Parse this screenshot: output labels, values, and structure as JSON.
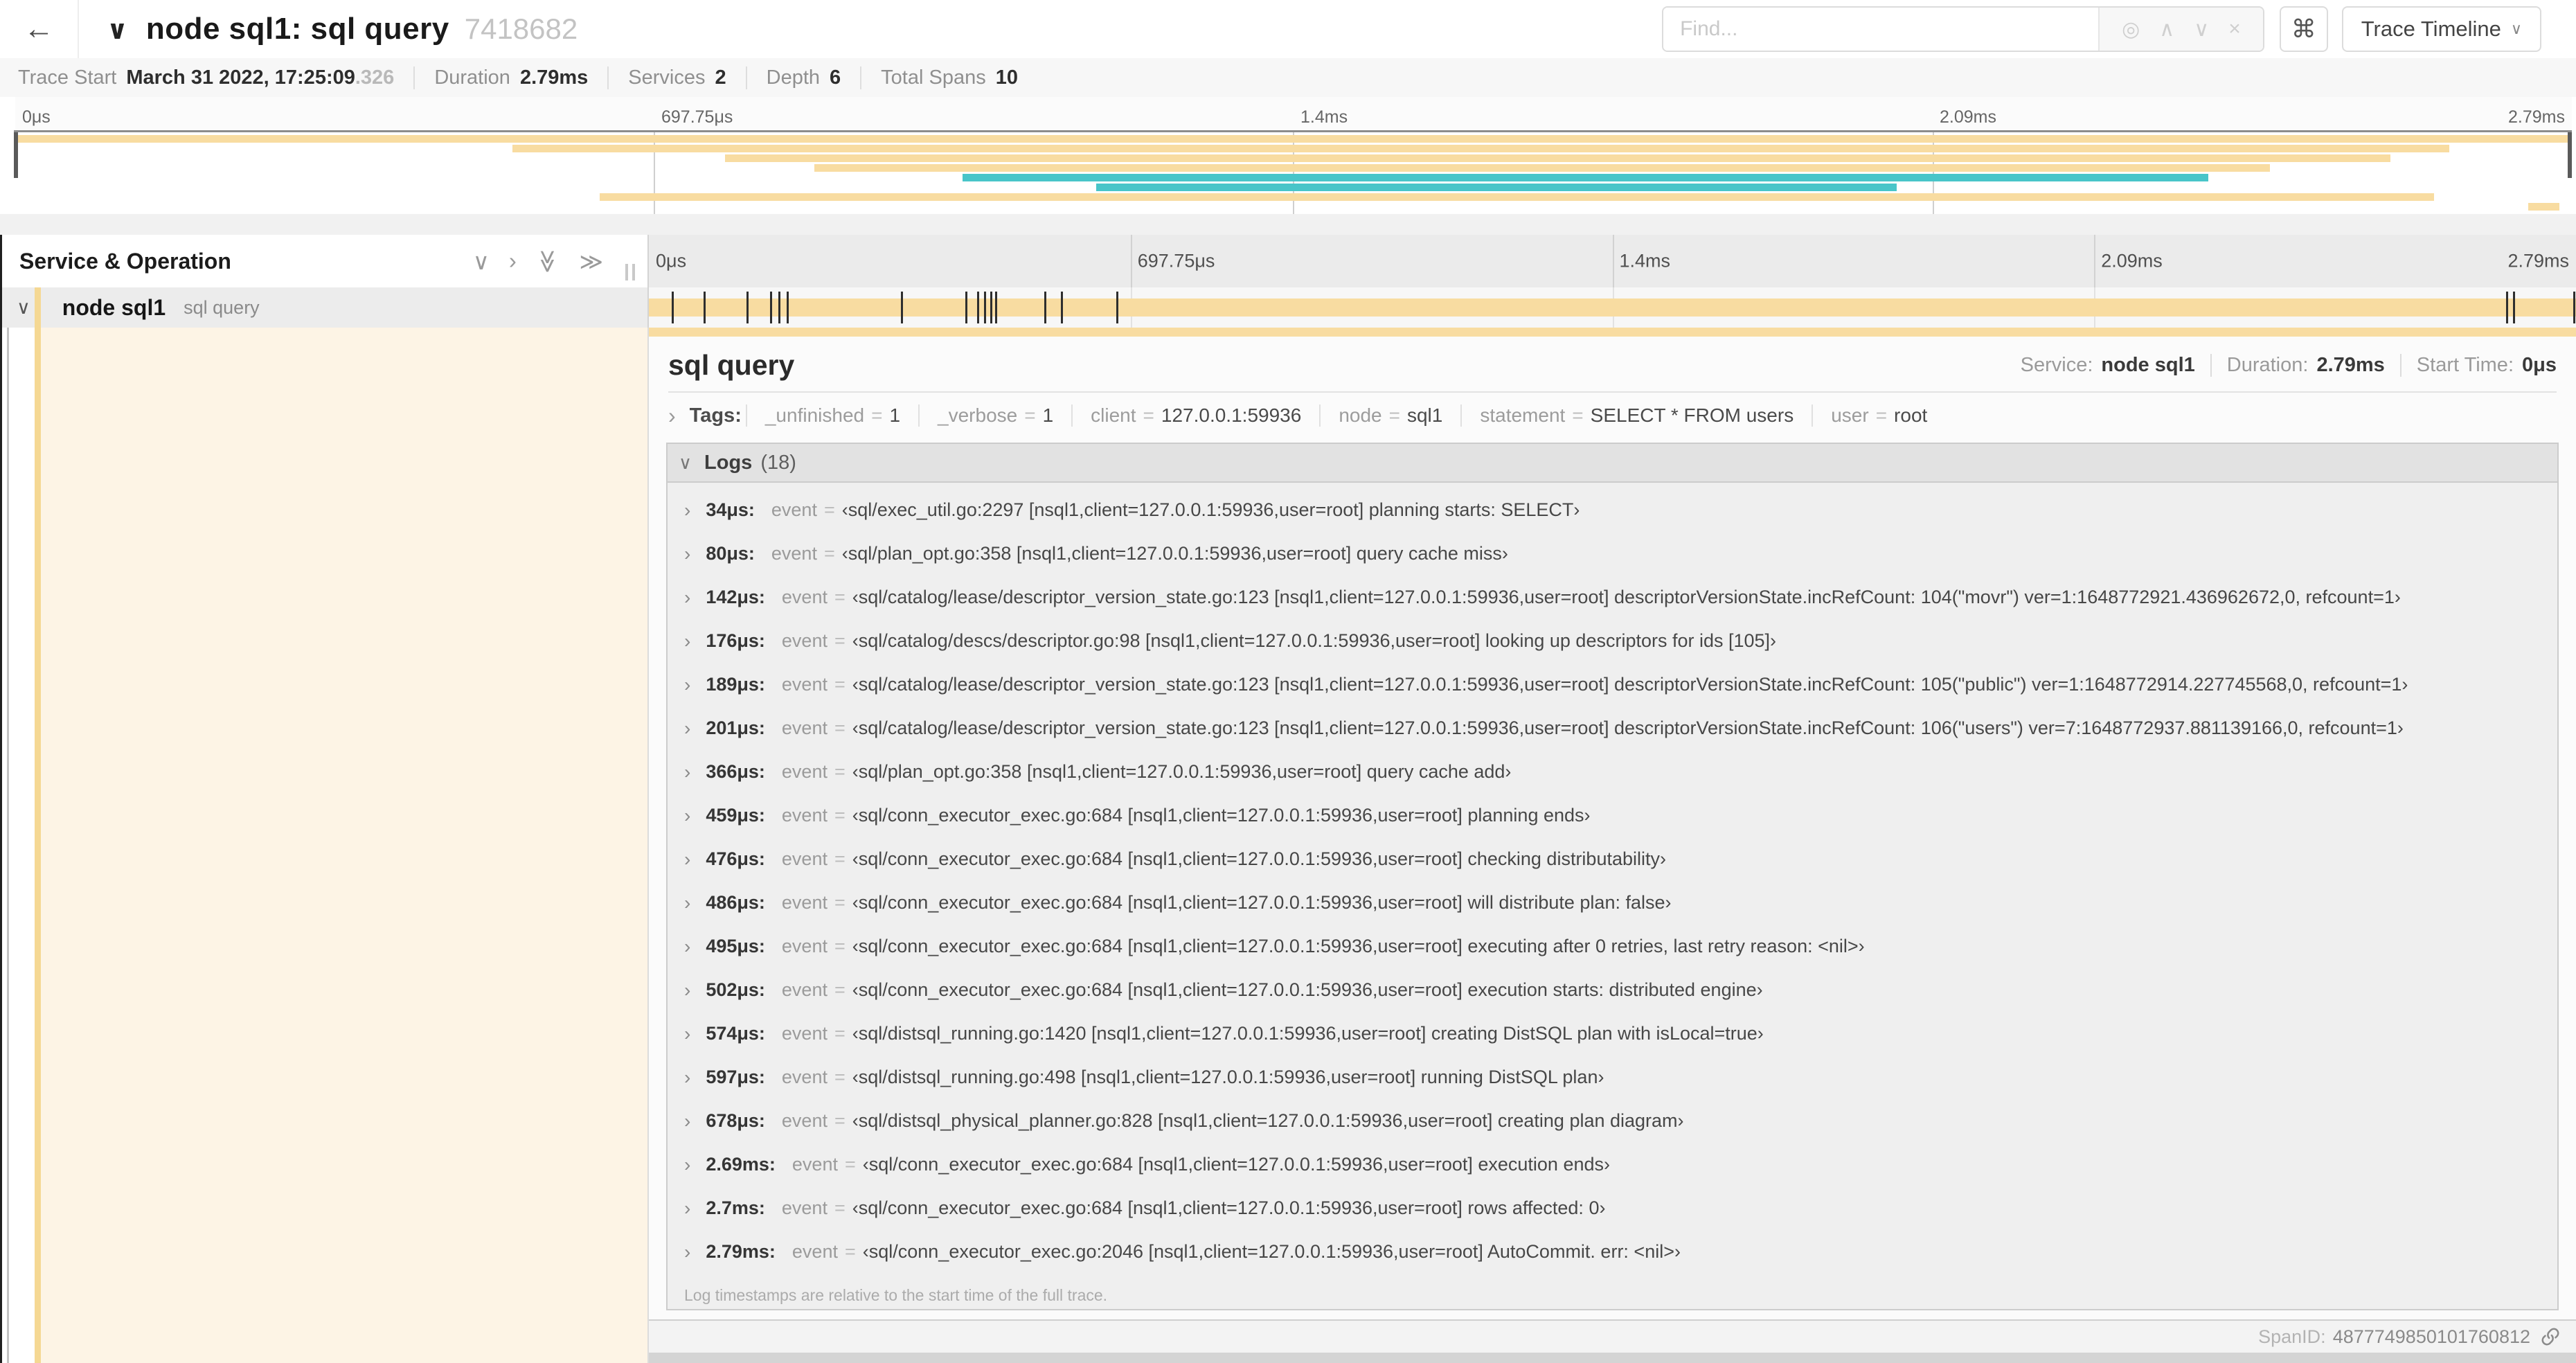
{
  "colors": {
    "tan": "#F8DCA1",
    "teal": "#48C5C9",
    "stripe": "#F5D893",
    "cream": "#FDF4E5"
  },
  "icons": {
    "back": "←",
    "collapse": "∨",
    "chevron_right": "›",
    "double_right": "≫",
    "target": "◎",
    "up": "∧",
    "down": "∨",
    "close": "×",
    "command": "⌘"
  },
  "topbar": {
    "title": "node sql1: sql query",
    "trace_id": "7418682",
    "find_placeholder": "Find...",
    "view_dropdown": "Trace Timeline"
  },
  "trace_meta": {
    "items": [
      {
        "label": "Trace Start",
        "value": "March 31 2022, 17:25:09",
        "suffix": ".326"
      },
      {
        "label": "Duration",
        "value": "2.79ms",
        "suffix": ""
      },
      {
        "label": "Services",
        "value": "2",
        "suffix": ""
      },
      {
        "label": "Depth",
        "value": "6",
        "suffix": ""
      },
      {
        "label": "Total Spans",
        "value": "10",
        "suffix": ""
      }
    ]
  },
  "timeline": {
    "ticks": [
      "0μs",
      "697.75μs",
      "1.4ms",
      "2.09ms",
      "2.79ms"
    ],
    "minimap_spans": [
      {
        "color": "tan",
        "start": 0,
        "end": 100
      },
      {
        "color": "tan",
        "start": 19.5,
        "end": 95.2
      },
      {
        "color": "tan",
        "start": 27.8,
        "end": 92.9
      },
      {
        "color": "tan",
        "start": 31.3,
        "end": 88.2
      },
      {
        "color": "teal",
        "start": 37.1,
        "end": 85.8
      },
      {
        "color": "teal",
        "start": 42.3,
        "end": 73.6
      },
      {
        "color": "tan",
        "start": 22.9,
        "end": 94.6
      },
      {
        "color": "tan",
        "start": 98.3,
        "end": 99.5
      }
    ]
  },
  "left_header": {
    "title": "Service & Operation"
  },
  "span_row": {
    "service": "node sql1",
    "operation": "sql query"
  },
  "detail": {
    "title": "sql query",
    "meta": [
      {
        "label": "Service:",
        "value": "node sql1"
      },
      {
        "label": "Duration:",
        "value": "2.79ms"
      },
      {
        "label": "Start Time:",
        "value": "0μs"
      }
    ],
    "tags": {
      "label": "Tags:",
      "items": [
        {
          "key": "_unfinished",
          "value": "1"
        },
        {
          "key": "_verbose",
          "value": "1"
        },
        {
          "key": "client",
          "value": "127.0.0.1:59936"
        },
        {
          "key": "node",
          "value": "sql1"
        },
        {
          "key": "statement",
          "value": "SELECT * FROM users"
        },
        {
          "key": "user",
          "value": "root"
        }
      ]
    },
    "logs": {
      "label": "Logs",
      "count": "(18)",
      "field_label": "event",
      "entries": [
        {
          "t": "34μs:",
          "pct": 1.22,
          "value": "‹sql/exec_util.go:2297 [nsql1,client=127.0.0.1:59936,user=root] planning starts: SELECT›"
        },
        {
          "t": "80μs:",
          "pct": 2.87,
          "value": "‹sql/plan_opt.go:358 [nsql1,client=127.0.0.1:59936,user=root] query cache miss›"
        },
        {
          "t": "142μs:",
          "pct": 5.09,
          "value": "‹sql/catalog/lease/descriptor_version_state.go:123 [nsql1,client=127.0.0.1:59936,user=root] descriptorVersionState.incRefCount: 104(\"movr\") ver=1:1648772921.436962672,0, refcount=1›"
        },
        {
          "t": "176μs:",
          "pct": 6.31,
          "value": "‹sql/catalog/descs/descriptor.go:98 [nsql1,client=127.0.0.1:59936,user=root] looking up descriptors for ids [105]›"
        },
        {
          "t": "189μs:",
          "pct": 6.77,
          "value": "‹sql/catalog/lease/descriptor_version_state.go:123 [nsql1,client=127.0.0.1:59936,user=root] descriptorVersionState.incRefCount: 105(\"public\") ver=1:1648772914.227745568,0, refcount=1›"
        },
        {
          "t": "201μs:",
          "pct": 7.2,
          "value": "‹sql/catalog/lease/descriptor_version_state.go:123 [nsql1,client=127.0.0.1:59936,user=root] descriptorVersionState.incRefCount: 106(\"users\") ver=7:1648772937.881139166,0, refcount=1›"
        },
        {
          "t": "366μs:",
          "pct": 13.12,
          "value": "‹sql/plan_opt.go:358 [nsql1,client=127.0.0.1:59936,user=root] query cache add›"
        },
        {
          "t": "459μs:",
          "pct": 16.45,
          "value": "‹sql/conn_executor_exec.go:684 [nsql1,client=127.0.0.1:59936,user=root] planning ends›"
        },
        {
          "t": "476μs:",
          "pct": 17.06,
          "value": "‹sql/conn_executor_exec.go:684 [nsql1,client=127.0.0.1:59936,user=root] checking distributability›"
        },
        {
          "t": "486μs:",
          "pct": 17.42,
          "value": "‹sql/conn_executor_exec.go:684 [nsql1,client=127.0.0.1:59936,user=root] will distribute plan: false›"
        },
        {
          "t": "495μs:",
          "pct": 17.74,
          "value": "‹sql/conn_executor_exec.go:684 [nsql1,client=127.0.0.1:59936,user=root] executing after 0 retries, last retry reason: <nil>›"
        },
        {
          "t": "502μs:",
          "pct": 18.0,
          "value": "‹sql/conn_executor_exec.go:684 [nsql1,client=127.0.0.1:59936,user=root] execution starts: distributed engine›"
        },
        {
          "t": "574μs:",
          "pct": 20.57,
          "value": "‹sql/distsql_running.go:1420 [nsql1,client=127.0.0.1:59936,user=root] creating DistSQL plan with isLocal=true›"
        },
        {
          "t": "597μs:",
          "pct": 21.4,
          "value": "‹sql/distsql_running.go:498 [nsql1,client=127.0.0.1:59936,user=root] running DistSQL plan›"
        },
        {
          "t": "678μs:",
          "pct": 24.3,
          "value": "‹sql/distsql_physical_planner.go:828 [nsql1,client=127.0.0.1:59936,user=root] creating plan diagram›"
        },
        {
          "t": "2.69ms:",
          "pct": 96.41,
          "value": "‹sql/conn_executor_exec.go:684 [nsql1,client=127.0.0.1:59936,user=root] execution ends›"
        },
        {
          "t": "2.7ms:",
          "pct": 96.77,
          "value": "‹sql/conn_executor_exec.go:684 [nsql1,client=127.0.0.1:59936,user=root] rows affected: 0›"
        },
        {
          "t": "2.79ms:",
          "pct": 99.9,
          "value": "‹sql/conn_executor_exec.go:2046 [nsql1,client=127.0.0.1:59936,user=root] AutoCommit. err: <nil>›"
        }
      ],
      "note": "Log timestamps are relative to the start time of the full trace."
    },
    "footer": {
      "label": "SpanID:",
      "value": "4877749850101760812"
    }
  }
}
